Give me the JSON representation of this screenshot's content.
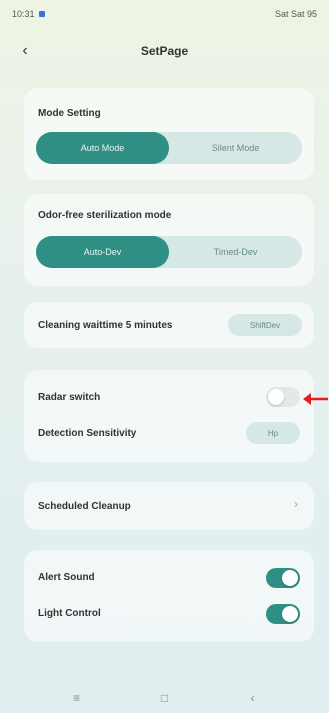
{
  "status": {
    "time": "10:31",
    "right": "Sat Sat 95"
  },
  "header": {
    "title": "SetPage"
  },
  "mode_setting": {
    "label": "Mode Setting",
    "options": [
      "Auto Mode",
      "Silent Mode"
    ],
    "selected": "Auto Mode"
  },
  "odor": {
    "label": "Odor-free sterilization mode",
    "options": [
      "Auto-Dev",
      "Timed-Dev"
    ],
    "selected": "Auto-Dev"
  },
  "cleaning": {
    "label": "Cleaning waittime 5 minutes",
    "button": "ShiftDev"
  },
  "radar": {
    "switch_label": "Radar switch",
    "switch_on": false,
    "sensitivity_label": "Detection Sensitivity",
    "sensitivity_value": "Hp"
  },
  "scheduled": {
    "label": "Scheduled Cleanup"
  },
  "alerts": {
    "sound_label": "Alert Sound",
    "sound_on": true,
    "light_label": "Light Control",
    "light_on": true
  },
  "colors": {
    "accent": "#2f8f84",
    "annotation": "#e02020"
  },
  "icons": {
    "back": "back-chevron-icon",
    "chevron": "chevron-right-icon",
    "nav": [
      "menu-icon",
      "home-icon",
      "back-icon"
    ]
  }
}
